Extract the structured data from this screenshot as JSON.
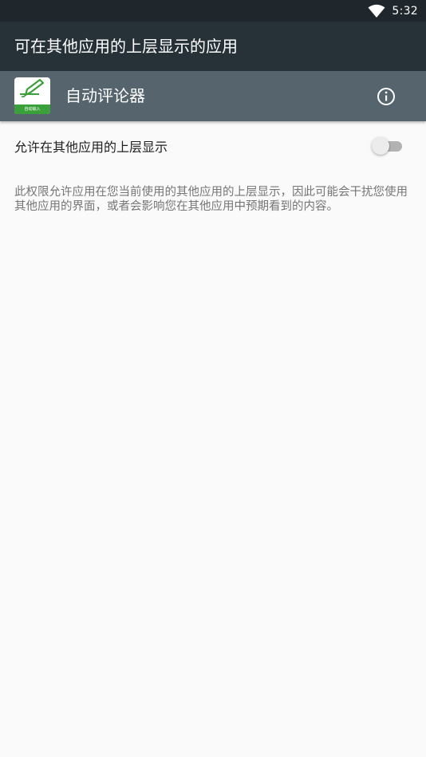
{
  "status_bar": {
    "time": "5:32",
    "wifi_icon": "wifi-icon"
  },
  "app_bar": {
    "title": "可在其他应用的上层显示的应用"
  },
  "app_header": {
    "icon": "app-icon",
    "app_name": "自动评论器",
    "icon_caption": "自动输入",
    "info_icon": "info-icon"
  },
  "setting": {
    "label": "允许在其他应用的上层显示",
    "enabled": false
  },
  "description": "此权限允许应用在您当前使用的其他应用的上层显示，因此可能会干扰您使用其他应用的界面，或者会影响您在其他应用中预期看到的内容。",
  "colors": {
    "status_bar": "#1f272c",
    "app_bar": "#263238",
    "app_header": "#56656d",
    "background": "#fafafa",
    "icon_green": "#3aa03a"
  }
}
